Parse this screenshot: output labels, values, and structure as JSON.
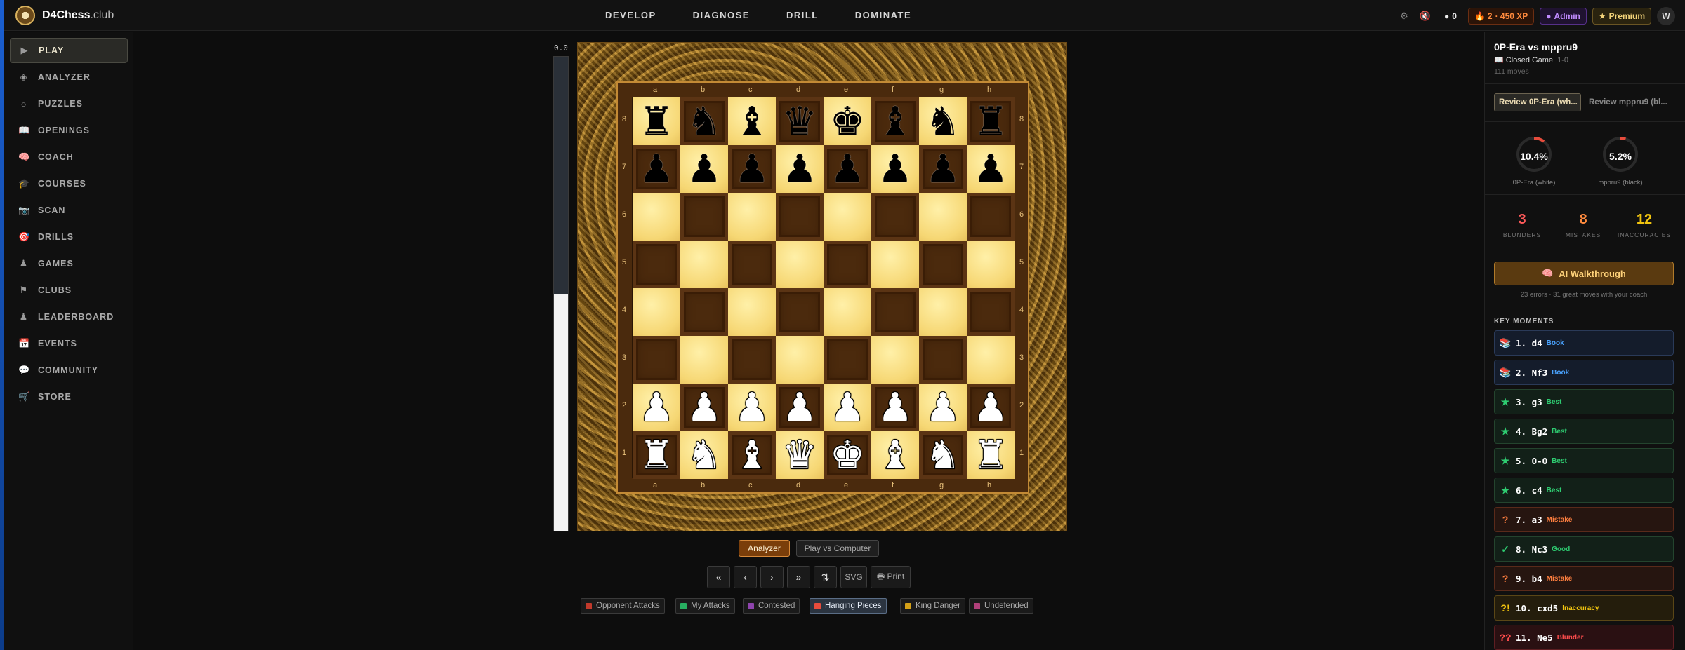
{
  "app": {
    "logo_name": "D4Chess",
    "logo_suffix": ".club"
  },
  "topnav": [
    "DEVELOP",
    "DIAGNOSE",
    "DRILL",
    "DOMINATE"
  ],
  "topbar": {
    "coins": "0",
    "streak": "2",
    "xp": "· 450 XP",
    "admin": "Admin",
    "premium": "Premium",
    "avatar": "W"
  },
  "sidebar": [
    {
      "label": "PLAY",
      "icon": "play-icon",
      "glyph": "▶",
      "active": true
    },
    {
      "label": "ANALYZER",
      "icon": "diamond-icon",
      "glyph": "◈"
    },
    {
      "label": "PUZZLES",
      "icon": "circle-icon",
      "glyph": "○"
    },
    {
      "label": "OPENINGS",
      "icon": "book-icon",
      "glyph": "📖"
    },
    {
      "label": "COACH",
      "icon": "brain-icon",
      "glyph": "🧠"
    },
    {
      "label": "COURSES",
      "icon": "graduation-cap-icon",
      "glyph": "🎓"
    },
    {
      "label": "SCAN",
      "icon": "camera-icon",
      "glyph": "📷"
    },
    {
      "label": "DRILLS",
      "icon": "target-icon",
      "glyph": "🎯"
    },
    {
      "label": "GAMES",
      "icon": "pawn-icon",
      "glyph": "♟"
    },
    {
      "label": "CLUBS",
      "icon": "flag-icon",
      "glyph": "⚑"
    },
    {
      "label": "LEADERBOARD",
      "icon": "pawn-icon",
      "glyph": "♟"
    },
    {
      "label": "EVENTS",
      "icon": "calendar-icon",
      "glyph": "📅"
    },
    {
      "label": "COMMUNITY",
      "icon": "chat-icon",
      "glyph": "💬"
    },
    {
      "label": "STORE",
      "icon": "cart-icon",
      "glyph": "🛒"
    }
  ],
  "eval": {
    "text": "0.0",
    "white_fraction": 0.5
  },
  "board": {
    "files": [
      "a",
      "b",
      "c",
      "d",
      "e",
      "f",
      "g",
      "h"
    ],
    "ranks": [
      "8",
      "7",
      "6",
      "5",
      "4",
      "3",
      "2",
      "1"
    ],
    "position": [
      [
        "r",
        "n",
        "b",
        "q",
        "k",
        "b",
        "n",
        "r"
      ],
      [
        "p",
        "p",
        "p",
        "p",
        "p",
        "p",
        "p",
        "p"
      ],
      [
        "",
        "",
        "",
        "",
        "",
        "",
        "",
        ""
      ],
      [
        "",
        "",
        "",
        "",
        "",
        "",
        "",
        ""
      ],
      [
        "",
        "",
        "",
        "",
        "",
        "",
        "",
        ""
      ],
      [
        "",
        "",
        "",
        "",
        "",
        "",
        "",
        ""
      ],
      [
        "P",
        "P",
        "P",
        "P",
        "P",
        "P",
        "P",
        "P"
      ],
      [
        "R",
        "N",
        "B",
        "Q",
        "K",
        "B",
        "N",
        "R"
      ]
    ]
  },
  "modes": {
    "analyzer": "Analyzer",
    "play_computer": "Play vs Computer"
  },
  "controls": {
    "first": "«",
    "prev": "‹",
    "next": "›",
    "last": "»",
    "flip": "⇅",
    "svg": "SVG",
    "print": "🖶 Print"
  },
  "overlays": [
    {
      "label": "Opponent Attacks",
      "color": "#c0392b",
      "on": false
    },
    {
      "label": "My Attacks",
      "color": "#27ae60",
      "on": false
    },
    {
      "label": "Contested",
      "color": "#8e44ad",
      "on": false
    },
    {
      "label": "Hanging Pieces",
      "color": "#e74c3c",
      "on": true
    },
    {
      "label": "King Danger",
      "color": "#d4a017",
      "on": false
    },
    {
      "label": "Undefended",
      "color": "#b0407a",
      "on": false
    }
  ],
  "game": {
    "title": "0P-Era vs mppru9",
    "opening": "📖 Closed Game",
    "result": "1-0",
    "moves": "111 moves",
    "review_white": "Review 0P-Era (wh...",
    "review_black": "Review mppru9 (bl...",
    "white_acc": "10.4%",
    "white_acc_value": 10.4,
    "white_label": "0P-Era (white)",
    "black_acc": "5.2%",
    "black_acc_value": 5.2,
    "black_label": "mppru9 (black)",
    "blunders": "3",
    "blunders_label": "BLUNDERS",
    "mistakes": "8",
    "mistakes_label": "MISTAKES",
    "inaccuracies": "12",
    "inaccuracies_label": "INACCURACIES",
    "ai_label": "AI Walkthrough",
    "ai_sub": "23 errors · 31 great moves with your coach",
    "key_moments_label": "KEY MOMENTS"
  },
  "moments": [
    {
      "move": "1. d4",
      "tag": "Book",
      "kind": "book",
      "icon": "book-icon",
      "glyph": "📚",
      "color": "#4aa3ff"
    },
    {
      "move": "2. Nf3",
      "tag": "Book",
      "kind": "book",
      "icon": "book-icon",
      "glyph": "📚",
      "color": "#4aa3ff"
    },
    {
      "move": "3. g3",
      "tag": "Best",
      "kind": "best",
      "icon": "star-icon",
      "glyph": "★",
      "color": "#2ecc71"
    },
    {
      "move": "4. Bg2",
      "tag": "Best",
      "kind": "best",
      "icon": "star-icon",
      "glyph": "★",
      "color": "#2ecc71"
    },
    {
      "move": "5. O-O",
      "tag": "Best",
      "kind": "best",
      "icon": "star-icon",
      "glyph": "★",
      "color": "#2ecc71"
    },
    {
      "move": "6. c4",
      "tag": "Best",
      "kind": "best",
      "icon": "star-icon",
      "glyph": "★",
      "color": "#2ecc71"
    },
    {
      "move": "7. a3",
      "tag": "Mistake",
      "kind": "mist",
      "icon": "question-icon",
      "glyph": "?",
      "color": "#ff7f3f"
    },
    {
      "move": "8. Nc3",
      "tag": "Good",
      "kind": "good",
      "icon": "check-icon",
      "glyph": "✓",
      "color": "#2ecc71"
    },
    {
      "move": "9. b4",
      "tag": "Mistake",
      "kind": "mist",
      "icon": "question-icon",
      "glyph": "?",
      "color": "#ff7f3f"
    },
    {
      "move": "10. cxd5",
      "tag": "Inaccuracy",
      "kind": "inac",
      "icon": "dubious-icon",
      "glyph": "?!",
      "color": "#f1c40f"
    },
    {
      "move": "11. Ne5",
      "tag": "Blunder",
      "kind": "blun",
      "icon": "blunder-icon",
      "glyph": "??",
      "color": "#ff4d4d"
    }
  ]
}
